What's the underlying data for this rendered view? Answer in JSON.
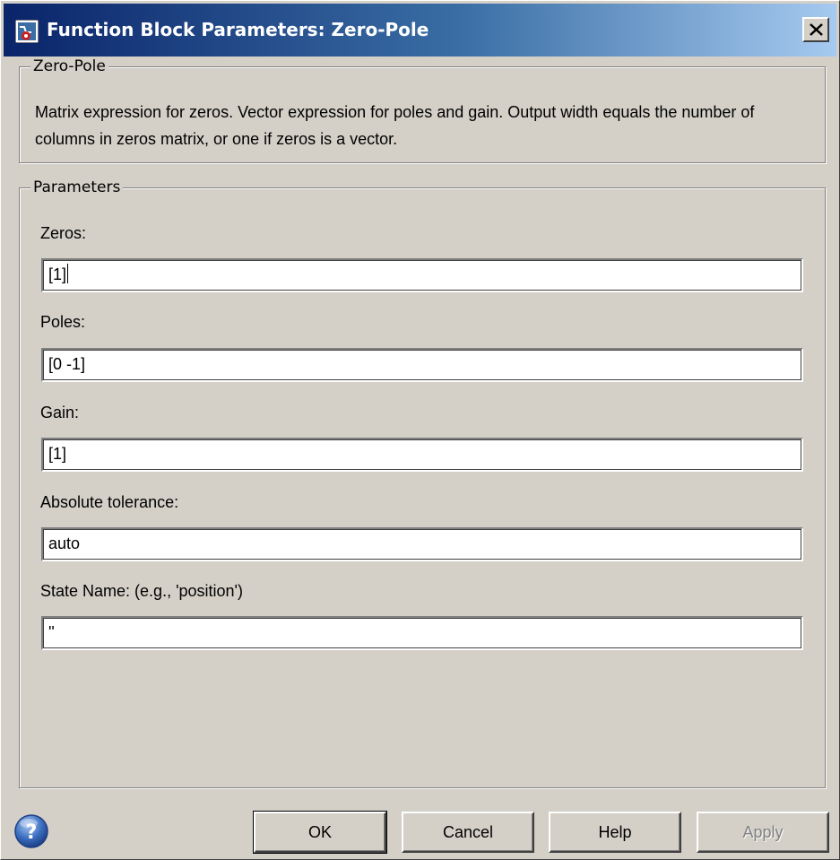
{
  "window": {
    "title": "Function Block Parameters: Zero-Pole",
    "close_glyph": "✕"
  },
  "zero_pole": {
    "legend": "Zero-Pole",
    "description": "Matrix expression for zeros.  Vector expression for poles and gain.  Output width equals the number of columns in zeros matrix, or one if zeros is a vector."
  },
  "parameters": {
    "legend": "Parameters",
    "zeros": {
      "label": "Zeros:",
      "value": "[1]"
    },
    "poles": {
      "label": "Poles:",
      "value": "[0 -1]"
    },
    "gain": {
      "label": "Gain:",
      "value": "[1]"
    },
    "abs_tol": {
      "label": "Absolute tolerance:",
      "value": "auto"
    },
    "state_name": {
      "label": "State Name: (e.g., 'position')",
      "value": "''"
    }
  },
  "buttons": {
    "ok": "OK",
    "cancel": "Cancel",
    "help": "Help",
    "apply": "Apply"
  },
  "icons": {
    "app": "simulink-block-icon",
    "close": "close-icon",
    "help": "help-icon"
  },
  "colors": {
    "title_bar_start": "#0a246a",
    "title_bar_end": "#a6caf0",
    "face": "#d4d0c8",
    "disabled_text": "#808080"
  }
}
